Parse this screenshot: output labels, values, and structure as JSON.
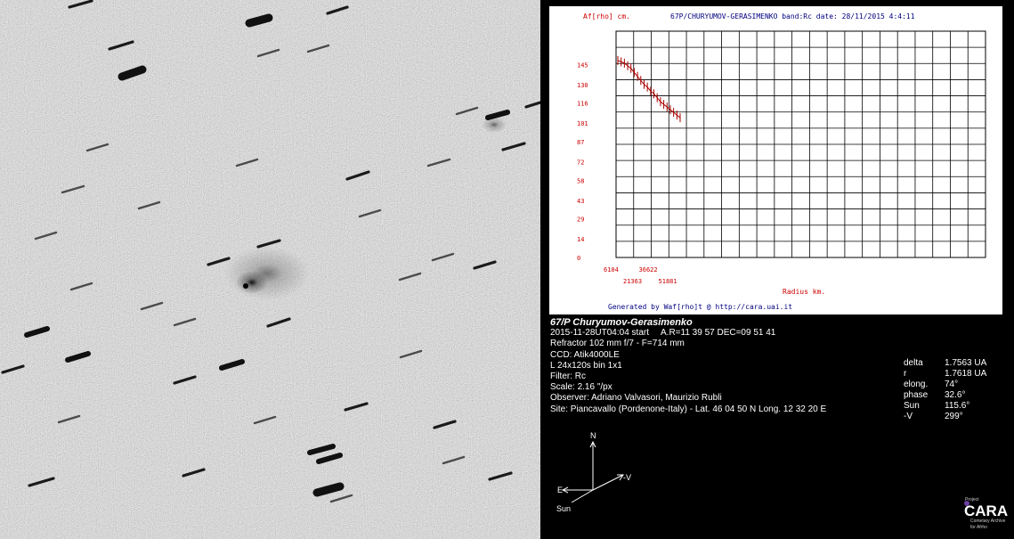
{
  "chart": {
    "y_unit_label": "Af[rho] cm.",
    "header": "67P/CHURYUMOV-GERASIMENKO     band:Rc date: 28/11/2015  4:4:11",
    "footer": "Generated by Waf[rho]t @ http://cara.uai.it",
    "x_unit_label": "Radius km.",
    "colors": {
      "axis_text": "#cc0000",
      "footer": "#000080",
      "grid": "#000000",
      "series": "#aa0000"
    }
  },
  "chart_data": {
    "type": "line",
    "title": "67P/CHURYUMOV-GERASIMENKO     band:Rc date: 28/11/2015  4:4:11",
    "xlabel": "Radius km.",
    "ylabel": "Af[rho] cm.",
    "ylim": [
      0,
      170
    ],
    "y_ticks": [
      "0",
      "14",
      "29",
      "43",
      "58",
      "72",
      "87",
      "101",
      "116",
      "130",
      "145"
    ],
    "x_tick_labels_top": [
      "6104",
      "36622"
    ],
    "x_tick_labels_bottom": [
      "21363",
      "51881"
    ],
    "grid": true,
    "series": [
      {
        "values": [
          148,
          147,
          146,
          144,
          142,
          139,
          136,
          133,
          130,
          128,
          125,
          123,
          120,
          117,
          115,
          113,
          111,
          109,
          107,
          105
        ]
      }
    ]
  },
  "info": {
    "title": "67/P Churyumov-Gerasimenko",
    "start": "2015-11-28UT04:04 start",
    "coords": "A.R=11 39 57  DEC=09 51 41",
    "telescope": "Refractor 102 mm f/7 - F=714 mm",
    "ccd": "CCD: Atik4000LE",
    "exposure": "L 24x120s bin 1x1",
    "filter": "Filter: Rc",
    "scale": "Scale: 2.16 \"/px",
    "observer": "Observer: Adriano Valvasori, Maurizio Rubli",
    "site": "Site: Piancavallo (Pordenone-Italy) - Lat. 46 04 50 N  Long. 12 32 20 E"
  },
  "ephemeris": [
    {
      "key": "delta",
      "value": "1.7563 UA"
    },
    {
      "key": "r",
      "value": "1.7618 UA"
    },
    {
      "key": "elong.",
      "value": "74°"
    },
    {
      "key": "phase",
      "value": "32.6°"
    },
    {
      "key": "Sun",
      "value": "115.6°"
    },
    {
      "key": "-V",
      "value": "299°"
    }
  ],
  "compass": {
    "north": "N",
    "east": "E",
    "minus_v": "-V",
    "sun": "Sun"
  },
  "logo": {
    "project": "Project",
    "name": "CARA",
    "line1": "Cometary Archive",
    "line2": "for Afrho"
  }
}
